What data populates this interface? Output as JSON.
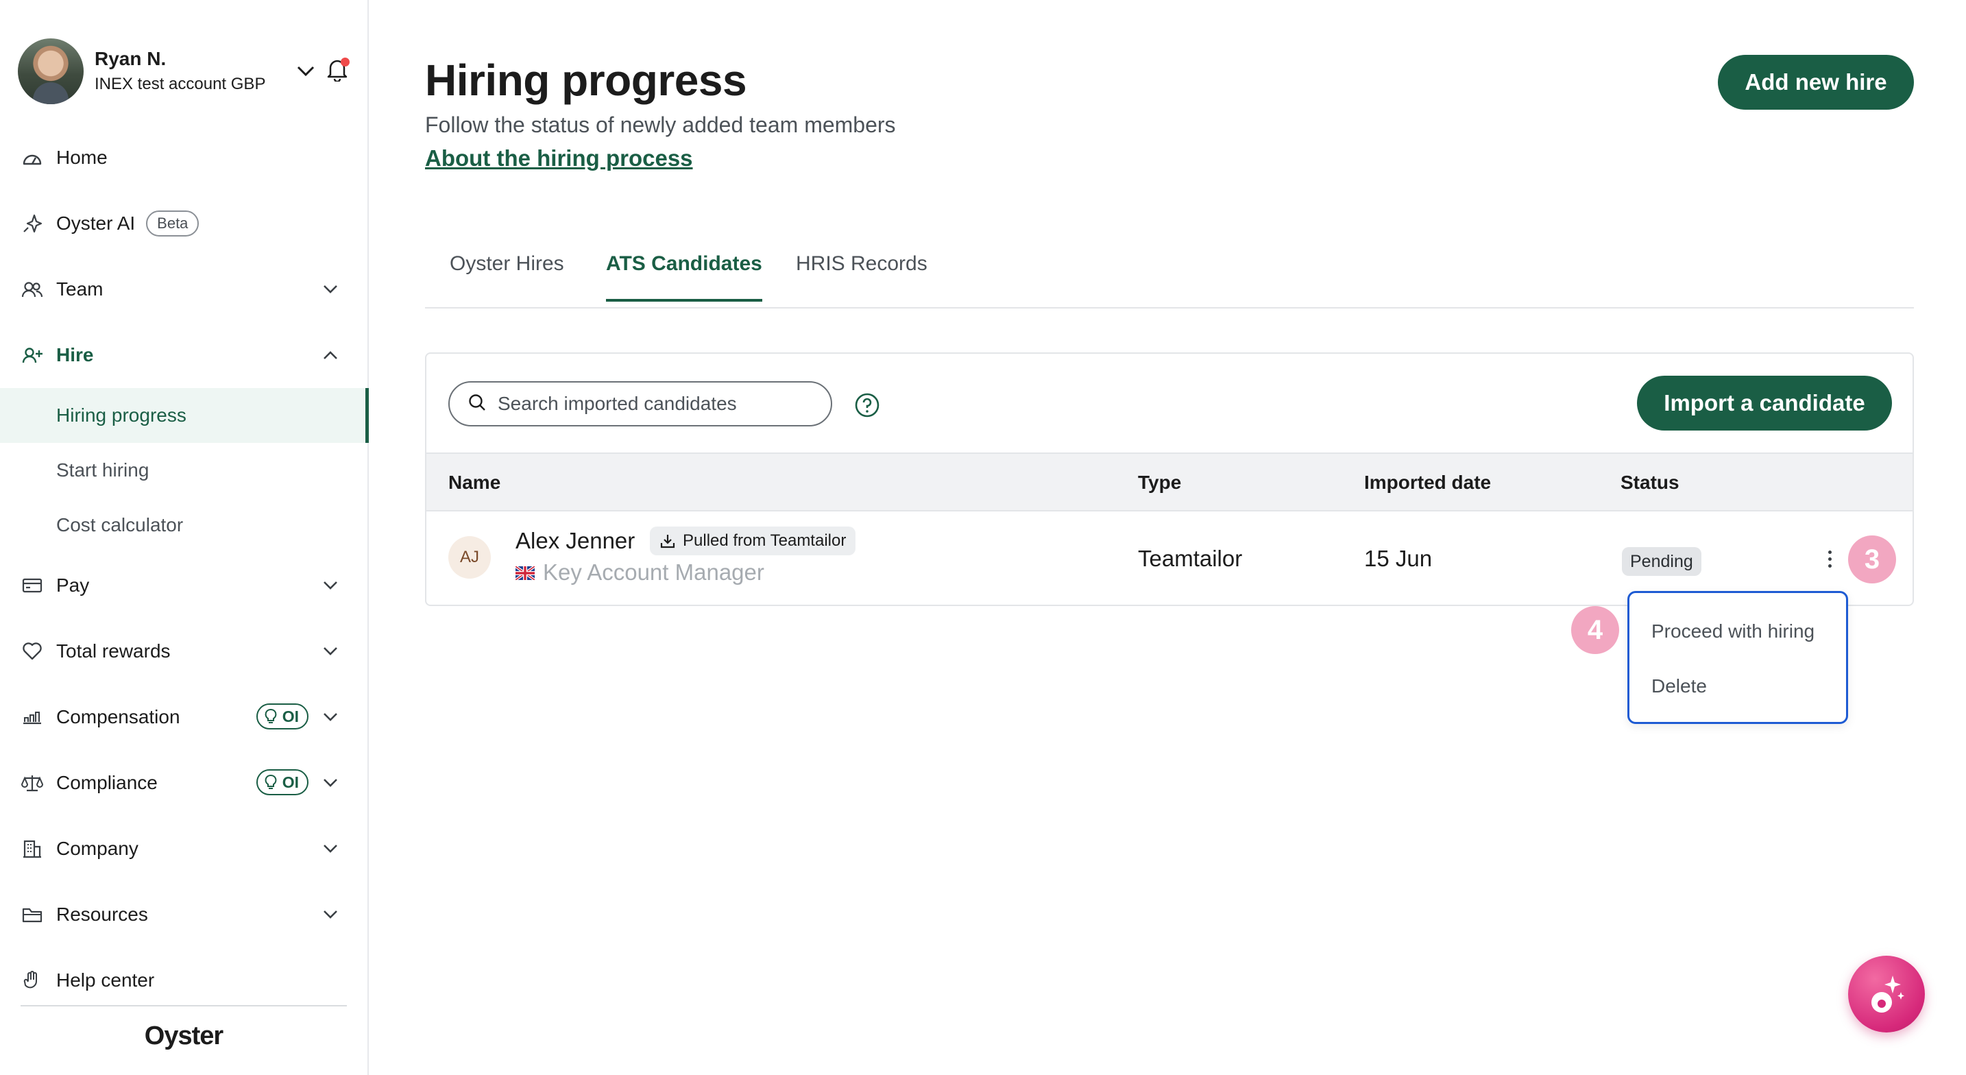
{
  "user": {
    "name": "Ryan N.",
    "account": "INEX test account GBP"
  },
  "sidebar": {
    "items": [
      {
        "label": "Home",
        "icon": "home-icon"
      },
      {
        "label": "Oyster AI",
        "badge": "Beta",
        "icon": "sparkle-icon"
      },
      {
        "label": "Team",
        "icon": "team-icon"
      },
      {
        "label": "Hire",
        "icon": "hire-icon",
        "expanded": true,
        "children": [
          "Hiring progress",
          "Start hiring",
          "Cost calculator"
        ]
      },
      {
        "label": "Pay",
        "icon": "card-icon"
      },
      {
        "label": "Total rewards",
        "icon": "heart-icon"
      },
      {
        "label": "Compensation",
        "badge": "OI",
        "icon": "chart-icon"
      },
      {
        "label": "Compliance",
        "badge": "OI",
        "icon": "scale-icon"
      },
      {
        "label": "Company",
        "icon": "building-icon"
      },
      {
        "label": "Resources",
        "icon": "folder-icon"
      },
      {
        "label": "Help center",
        "icon": "hand-icon"
      }
    ],
    "brand": "Oyster"
  },
  "page": {
    "title": "Hiring progress",
    "subtitle": "Follow the status of newly added team members",
    "link": "About the hiring process",
    "add_button": "Add new hire"
  },
  "tabs": [
    "Oyster Hires",
    "ATS Candidates",
    "HRIS Records"
  ],
  "active_tab": "ATS Candidates",
  "candidates": {
    "search_placeholder": "Search imported candidates",
    "import_button": "Import a candidate",
    "columns": [
      "Name",
      "Type",
      "Imported date",
      "Status"
    ],
    "rows": [
      {
        "initials": "AJ",
        "name": "Alex Jenner",
        "source_badge": "Pulled from Teamtailor",
        "role": "Key Account Manager",
        "type": "Teamtailor",
        "imported_date": "15 Jun",
        "status": "Pending"
      }
    ]
  },
  "row_menu": {
    "items": [
      "Proceed with hiring",
      "Delete"
    ]
  },
  "markers": [
    "3",
    "4"
  ],
  "colors": {
    "brand_green": "#1a5e45",
    "focus_blue": "#1e5bd3",
    "marker_pink": "#f2a7c1",
    "notification_red": "#ef4a4a"
  }
}
